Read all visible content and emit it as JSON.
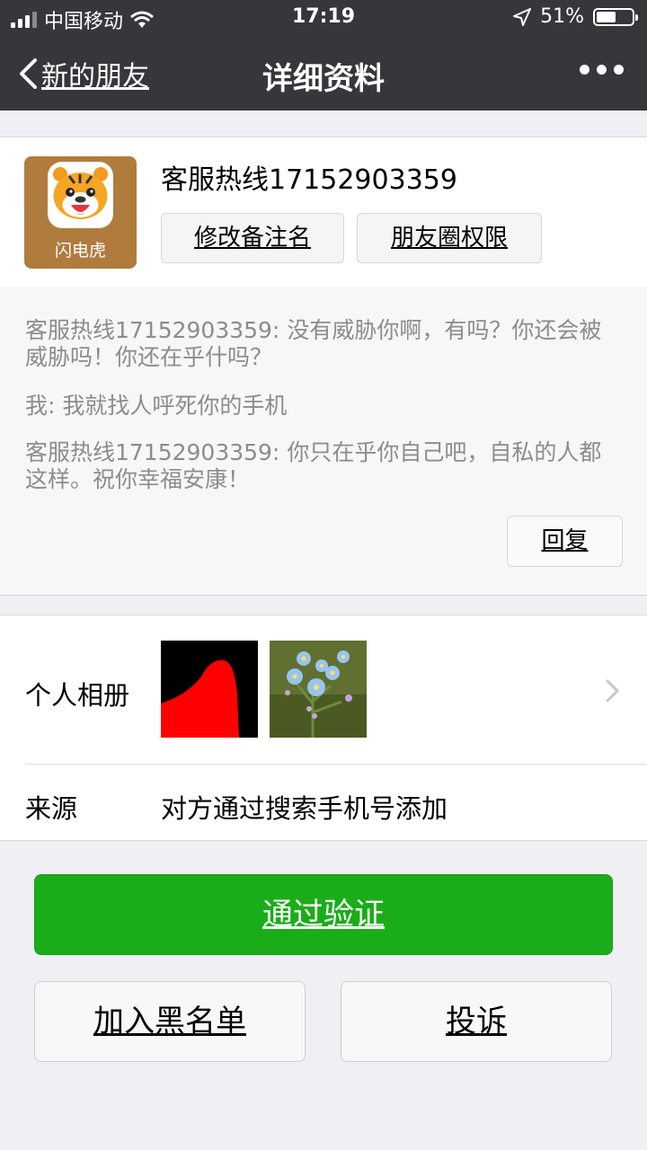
{
  "status_bar": {
    "carrier": "中国移动",
    "time": "17:19",
    "battery": "51%",
    "battery_level": 0.51
  },
  "nav": {
    "back_label": "新的朋友",
    "title": "详细资料"
  },
  "profile": {
    "avatar_label": "闪电虎",
    "name": "客服热线17152903359",
    "remark_button": "修改备注名",
    "moments_button": "朋友圈权限"
  },
  "messages": [
    "客服热线17152903359: 没有威胁你啊，有吗？你还会被威胁吗！你还在乎什吗？",
    "我: 我就找人呼死你的手机",
    "客服热线17152903359: 你只在乎你自己吧，自私的人都这样。祝你幸福安康！"
  ],
  "reply_button": "回复",
  "album": {
    "label": "个人相册"
  },
  "source": {
    "label": "来源",
    "value": "对方通过搜索手机号添加"
  },
  "actions": {
    "approve": "通过验证",
    "block": "加入黑名单",
    "report": "投诉"
  },
  "colors": {
    "nav_bg": "#37373b",
    "approve_green": "#1aad19"
  }
}
